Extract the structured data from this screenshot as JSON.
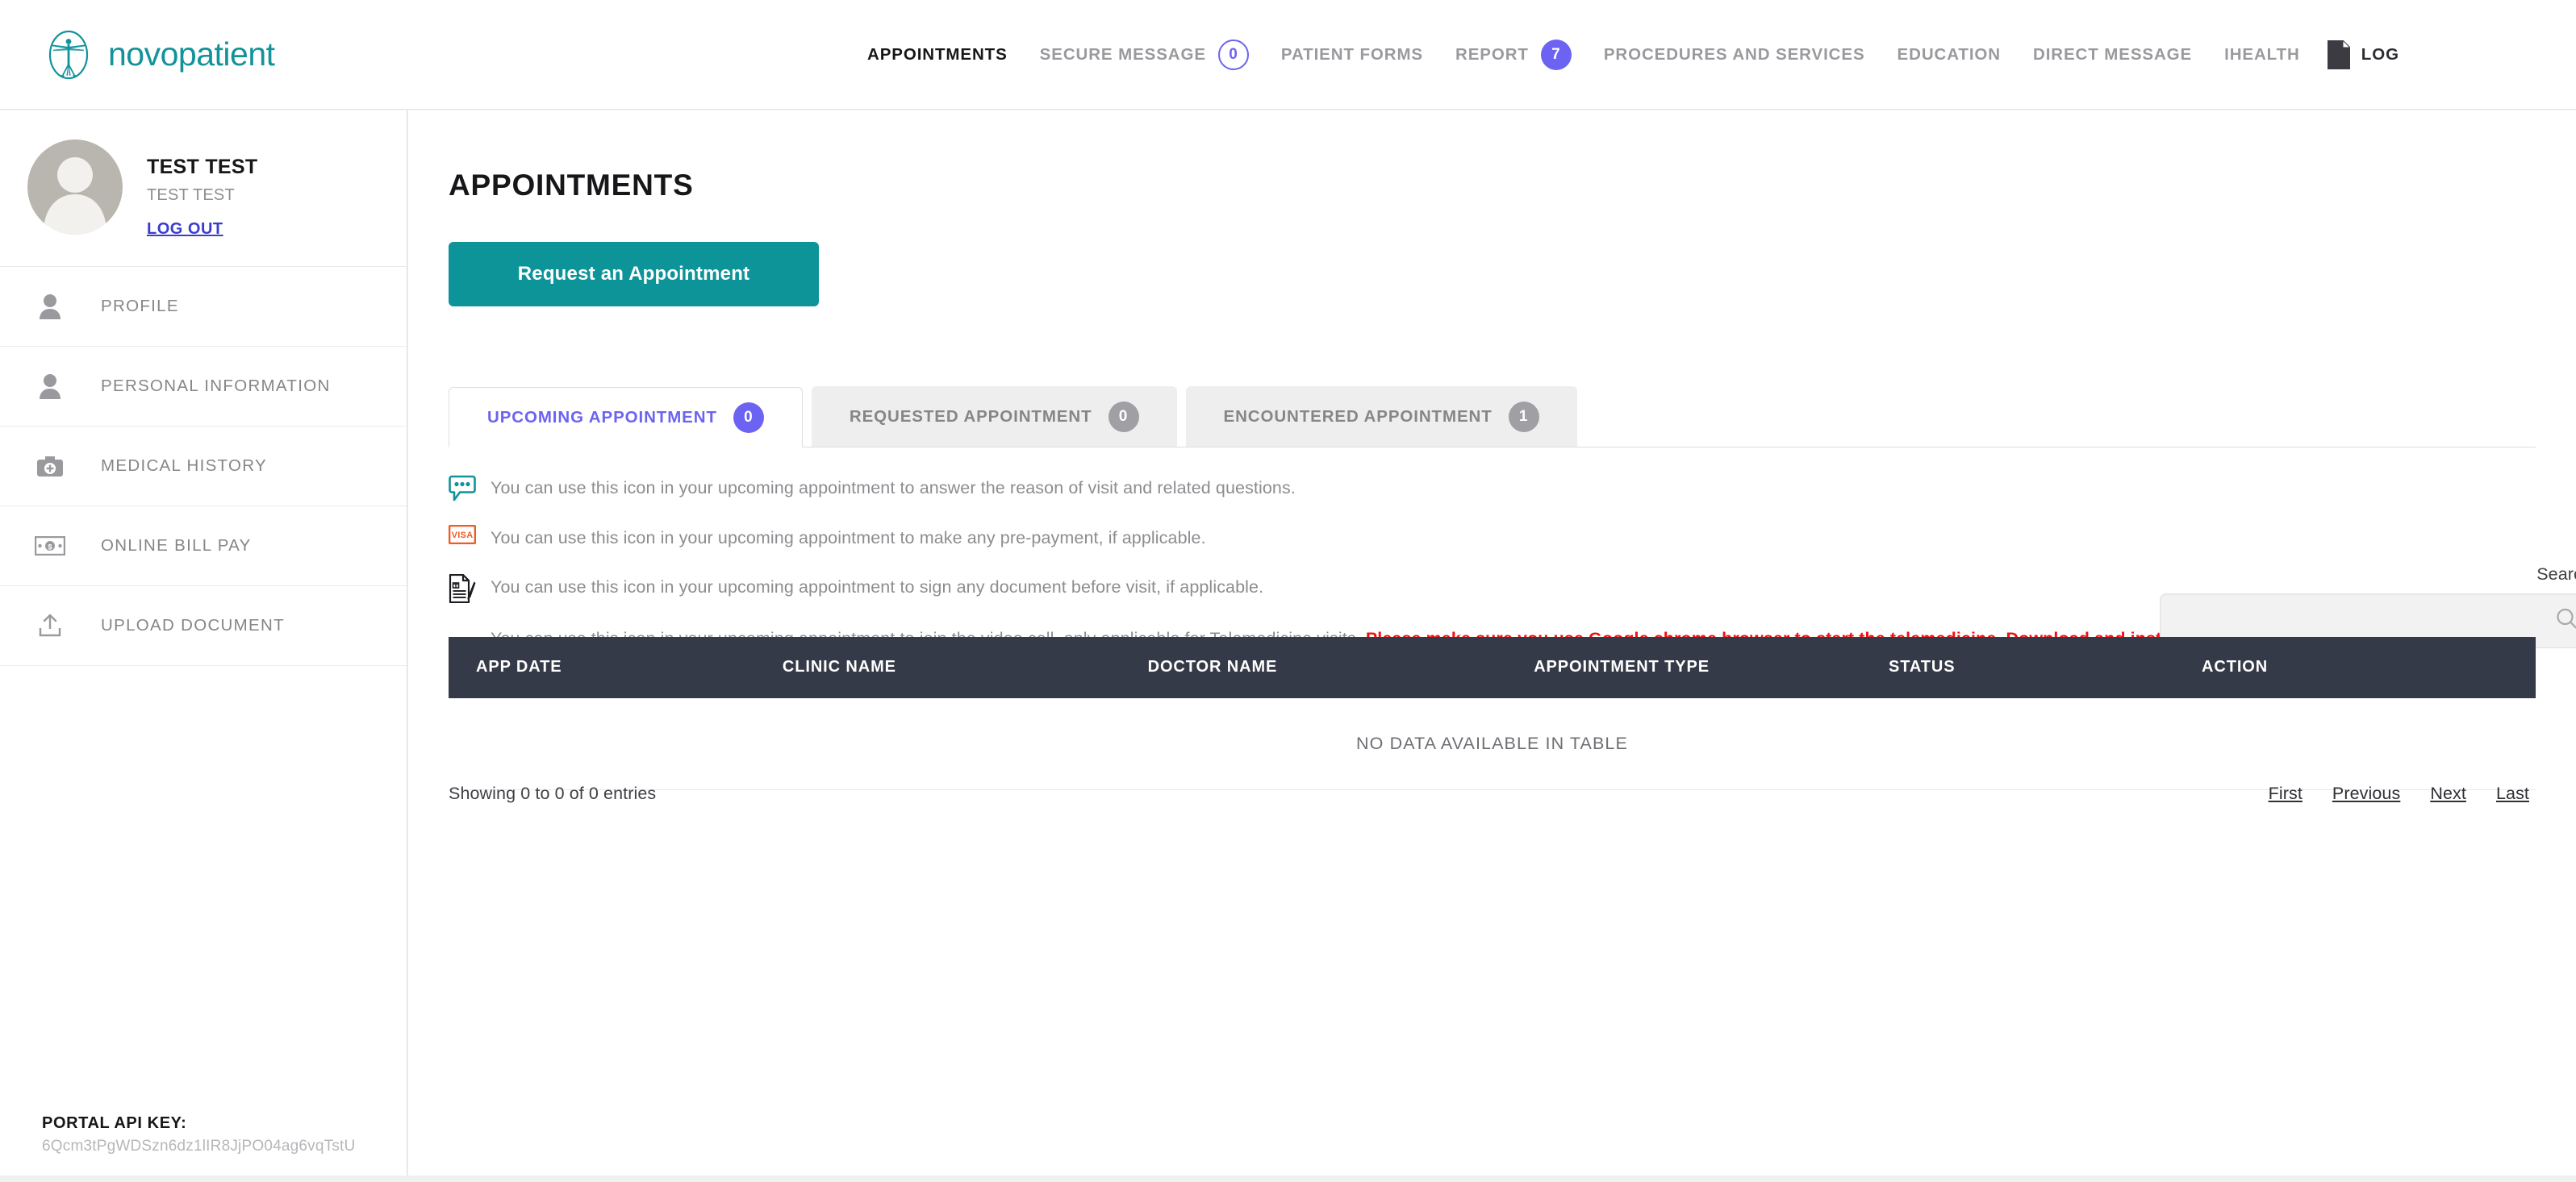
{
  "brand": {
    "name": "novopatient",
    "logo_icon": "vitruvian-man-icon",
    "color": "#12939a"
  },
  "topnav": {
    "items": [
      {
        "label": "APPOINTMENTS",
        "active": true,
        "badge": null
      },
      {
        "label": "SECURE MESSAGE",
        "active": false,
        "badge": "0",
        "badge_style": "hollow"
      },
      {
        "label": "PATIENT FORMS",
        "active": false,
        "badge": null
      },
      {
        "label": "REPORT",
        "active": false,
        "badge": "7",
        "badge_style": "solid"
      },
      {
        "label": "PROCEDURES AND SERVICES",
        "active": false,
        "badge": null
      },
      {
        "label": "EDUCATION",
        "active": false,
        "badge": null
      },
      {
        "label": "DIRECT MESSAGE",
        "active": false,
        "badge": null
      },
      {
        "label": "IHEALTH",
        "active": false,
        "badge": null
      }
    ],
    "log": {
      "label": "LOG",
      "icon": "document-icon"
    },
    "badge_color": "#6c63f2"
  },
  "sidebar": {
    "profile": {
      "name": "TEST TEST",
      "subtitle": "TEST TEST",
      "logout_label": "LOG OUT",
      "avatar_icon": "user-avatar-placeholder-icon"
    },
    "items": [
      {
        "label": "PROFILE",
        "icon": "person-icon"
      },
      {
        "label": "PERSONAL INFORMATION",
        "icon": "person-icon"
      },
      {
        "label": "MEDICAL HISTORY",
        "icon": "medical-bag-icon"
      },
      {
        "label": "ONLINE BILL PAY",
        "icon": "money-bill-icon"
      },
      {
        "label": "UPLOAD DOCUMENT",
        "icon": "upload-icon"
      }
    ],
    "api_key": {
      "title": "PORTAL API KEY:",
      "value": "6Qcm3tPgWDSzn6dz1lIR8JjPO04ag6vqTstU"
    }
  },
  "main": {
    "title": "APPOINTMENTS",
    "request_button": "Request an Appointment",
    "accent_color": "#0d9499",
    "tabs": [
      {
        "label": "UPCOMING APPOINTMENT",
        "badge": "0",
        "active": true
      },
      {
        "label": "REQUESTED APPOINTMENT",
        "badge": "0",
        "active": false
      },
      {
        "label": "ENCOUNTERED APPOINTMENT",
        "badge": "1",
        "active": false
      }
    ],
    "legend": [
      {
        "icon": "speech-bubble-icon",
        "text": "You can use this icon in your upcoming appointment to answer the reason of visit and related questions."
      },
      {
        "icon": "visa-card-icon",
        "text": "You can use this icon in your upcoming appointment to make any pre-payment, if applicable."
      },
      {
        "icon": "sign-document-icon",
        "text": "You can use this icon in your upcoming appointment to sign any document before visit, if applicable."
      }
    ],
    "legend_video": {
      "icon": "video-camera-icon",
      "text": "You can use this icon in your upcoming appointment to join the video call, only applicable for Telemedicine visits. ",
      "warning": "Please make sure you use Google chrome browser to start the telemedicine. Download and install Google chrome if you do not have that already. Then login to patient portal, and click the icon to join the appointment.",
      "warning_color": "#f40f0f"
    },
    "search": {
      "label": "Search:",
      "value": "",
      "placeholder": "",
      "icon": "search-icon"
    },
    "table": {
      "columns": [
        "APP DATE",
        "CLINIC NAME",
        "DOCTOR NAME",
        "APPOINTMENT TYPE",
        "STATUS",
        "ACTION"
      ],
      "rows": [],
      "empty_message": "NO DATA AVAILABLE IN TABLE",
      "header_bg": "#343a47"
    },
    "footer": {
      "entries_info": "Showing 0 to 0 of 0 entries",
      "pagination": [
        "First",
        "Previous",
        "Next",
        "Last"
      ]
    }
  }
}
